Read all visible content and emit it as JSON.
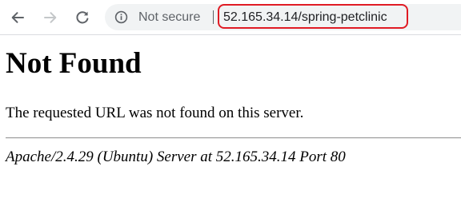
{
  "browser": {
    "nav": {
      "back_icon": "back-arrow-icon",
      "forward_icon": "forward-arrow-icon",
      "reload_icon": "reload-icon"
    },
    "omnibox": {
      "security_icon": "info-icon",
      "security_label": "Not secure",
      "url": "52.165.34.14/spring-petclinic",
      "url_highlight_color": "#e01b24"
    }
  },
  "page": {
    "title": "Not Found",
    "message": "The requested URL was not found on this server.",
    "server_signature": "Apache/2.4.29 (Ubuntu) Server at 52.165.34.14 Port 80"
  }
}
